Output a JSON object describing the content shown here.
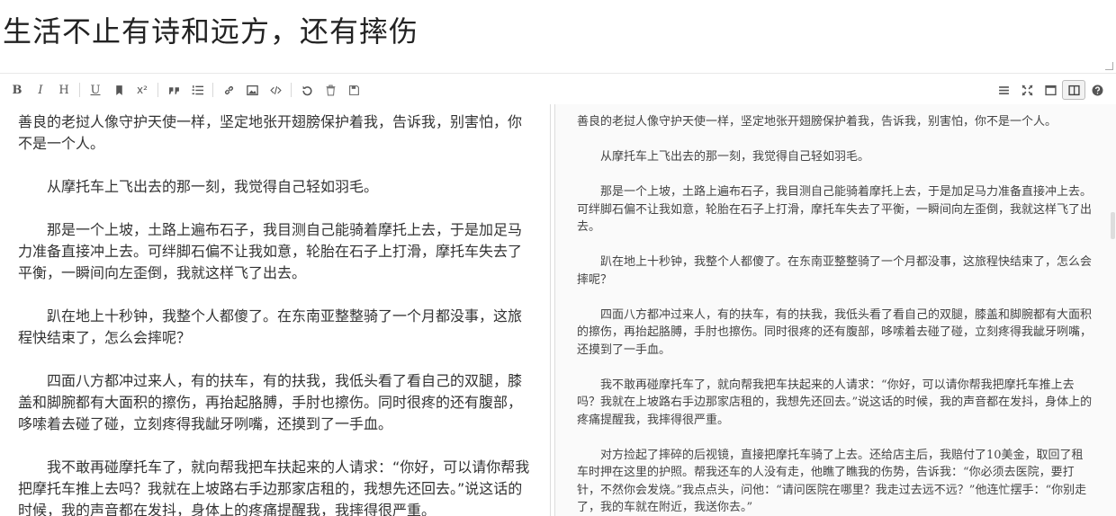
{
  "title": "生活不止有诗和远方，还有摔伤",
  "toolbar": {
    "left": [
      {
        "name": "bold-button",
        "glyph": "B"
      },
      {
        "name": "italic-button",
        "glyph": "I"
      },
      {
        "name": "heading-button",
        "glyph": "H"
      },
      {
        "name": "underline-button",
        "glyph": "U"
      },
      {
        "name": "bookmark-button",
        "glyph": "bookmark-icon"
      },
      {
        "name": "superscript-button",
        "glyph": "x²"
      },
      {
        "name": "quote-button",
        "glyph": "quote-icon"
      },
      {
        "name": "ordered-list-button",
        "glyph": "ordered-list-icon"
      },
      {
        "name": "link-button",
        "glyph": "link-icon"
      },
      {
        "name": "image-button",
        "glyph": "image-icon"
      },
      {
        "name": "code-button",
        "glyph": "code-icon"
      },
      {
        "name": "undo-button",
        "glyph": "undo-icon"
      },
      {
        "name": "trash-button",
        "glyph": "trash-icon"
      },
      {
        "name": "save-button",
        "glyph": "save-icon"
      }
    ],
    "right": [
      {
        "name": "menu-button",
        "glyph": "menu-icon"
      },
      {
        "name": "fullscreen-button",
        "glyph": "fullscreen-icon"
      },
      {
        "name": "single-pane-button",
        "glyph": "window-icon"
      },
      {
        "name": "split-view-button",
        "glyph": "columns-icon"
      },
      {
        "name": "help-button",
        "glyph": "help-icon"
      }
    ]
  },
  "editor": {
    "paragraphs": [
      "善良的老挝人像守护天使一样，坚定地张开翅膀保护着我，告诉我，别害怕，你不是一个人。",
      "　　从摩托车上飞出去的那一刻，我觉得自己轻如羽毛。",
      "　　那是一个上坡，土路上遍布石子，我目测自己能骑着摩托上去，于是加足马力准备直接冲上去。可绊脚石偏不让我如意，轮胎在石子上打滑，摩托车失去了平衡，一瞬间向左歪倒，我就这样飞了出去。",
      "　　趴在地上十秒钟，我整个人都傻了。在东南亚整整骑了一个月都没事，这旅程快结束了，怎么会摔呢？",
      "　　四面八方都冲过来人，有的扶车，有的扶我，我低头看了看自己的双腿，膝盖和脚腕都有大面积的擦伤，再抬起胳膊，手肘也擦伤。同时很疼的还有腹部，哆嗦着去碰了碰，立刻疼得我龇牙咧嘴，还摸到了一手血。",
      "　　我不敢再碰摩托车了，就向帮我把车扶起来的人请求：“你好，可以请你帮我把摩托车推上去吗？我就在上坡路右手边那家店租的，我想先还回去。”说这话的时候，我的声音都在发抖，身体上的疼痛提醒我，我摔得很严重。"
    ]
  },
  "preview": {
    "paragraphs": [
      "善良的老挝人像守护天使一样，坚定地张开翅膀保护着我，告诉我，别害怕，你不是一个人。",
      "　　从摩托车上飞出去的那一刻，我觉得自己轻如羽毛。",
      "　　那是一个上坡，土路上遍布石子，我目测自己能骑着摩托上去，于是加足马力准备直接冲上去。可绊脚石偏不让我如意，轮胎在石子上打滑，摩托车失去了平衡，一瞬间向左歪倒，我就这样飞了出去。",
      "　　趴在地上十秒钟，我整个人都傻了。在东南亚整整骑了一个月都没事，这旅程快结束了，怎么会摔呢？",
      "　　四面八方都冲过来人，有的扶车，有的扶我，我低头看了看自己的双腿，膝盖和脚腕都有大面积的擦伤，再抬起胳膊，手肘也擦伤。同时很疼的还有腹部，哆嗦着去碰了碰，立刻疼得我龇牙咧嘴，还摸到了一手血。",
      "　　我不敢再碰摩托车了，就向帮我把车扶起来的人请求：“你好，可以请你帮我把摩托车推上去吗？我就在上坡路右手边那家店租的，我想先还回去。”说这话的时候，我的声音都在发抖，身体上的疼痛提醒我，我摔得很严重。",
      "　　对方捡起了摔碎的后视镜，直接把摩托车骑了上去。还给店主后，我赔付了10美金，取回了租车时押在这里的护照。帮我还车的人没有走，他瞧了瞧我的伤势，告诉我：“你必须去医院，要打针，不然你会发烧。”我点点头，问他：“请问医院在哪里？我走过去远不远？”他连忙摆手：“你别走了，我的车就在附近，我送你去。”"
    ]
  }
}
